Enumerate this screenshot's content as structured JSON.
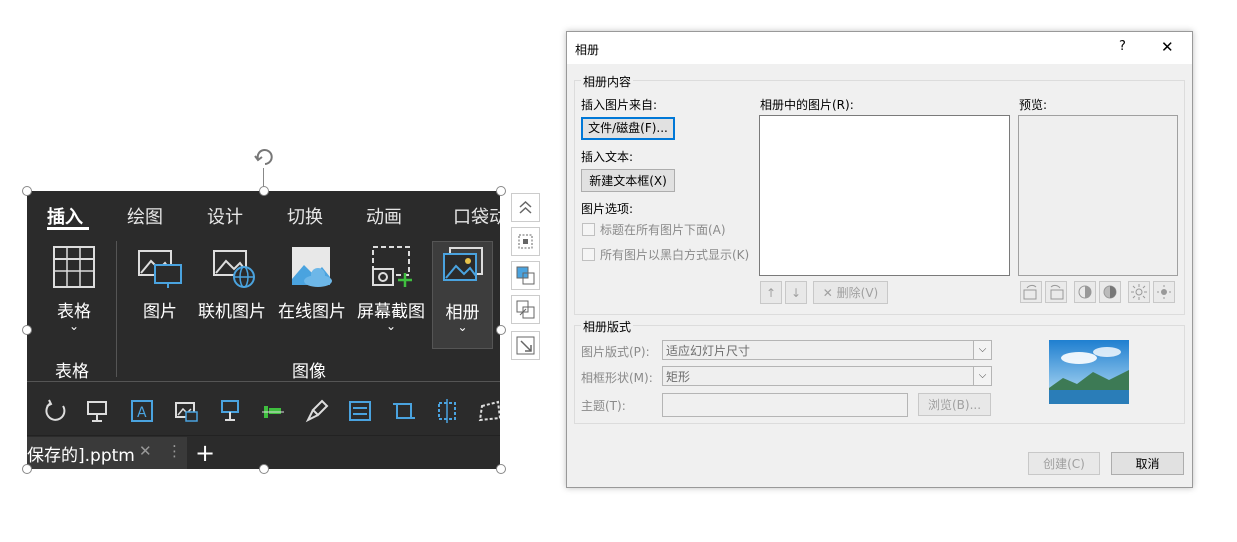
{
  "ribbon": {
    "tabs": [
      "插入",
      "绘图",
      "设计",
      "切换",
      "动画",
      "口袋动"
    ],
    "buttons": [
      {
        "label": "表格",
        "chevron": "⌄"
      },
      {
        "label": "图片"
      },
      {
        "label": "联机图片"
      },
      {
        "label": "在线图片"
      },
      {
        "label": "屏幕截图",
        "chevron": "⌄"
      },
      {
        "label": "相册",
        "chevron": "⌄"
      }
    ],
    "groups": [
      "表格",
      "图像"
    ],
    "document_tab": "保存的].pptm",
    "new_tab": "+",
    "close_glyph": "✕",
    "more_glyph": "⋮"
  },
  "dialog": {
    "title": "相册",
    "help": "?",
    "close": "✕",
    "album_content": "相册内容",
    "insert_from": "插入图片来自:",
    "file_disk_button": "文件/磁盘(F)...",
    "insert_text": "插入文本:",
    "new_textbox_button": "新建文本框(X)",
    "picture_options": "图片选项:",
    "option_captions": "标题在所有图片下面(A)",
    "option_bw": "所有图片以黑白方式显示(K)",
    "pictures_in_album": "相册中的图片(R):",
    "preview": "预览:",
    "delete_button": "删除(V)",
    "up_glyph": "↑",
    "down_glyph": "↓",
    "delete_glyph": "✕",
    "album_layout": "相册版式",
    "picture_layout_label": "图片版式(P):",
    "picture_layout_value": "适应幻灯片尺寸",
    "frame_shape_label": "相框形状(M):",
    "frame_shape_value": "矩形",
    "theme_label": "主题(T):",
    "theme_value": "",
    "browse_button": "浏览(B)...",
    "create_button": "创建(C)",
    "cancel_button": "取消"
  },
  "colors": {
    "ribbon_bg": "#2b2b2b",
    "accent": "#0078d7",
    "icon_blue": "#4aa3df",
    "icon_green": "#3fbf3f"
  }
}
